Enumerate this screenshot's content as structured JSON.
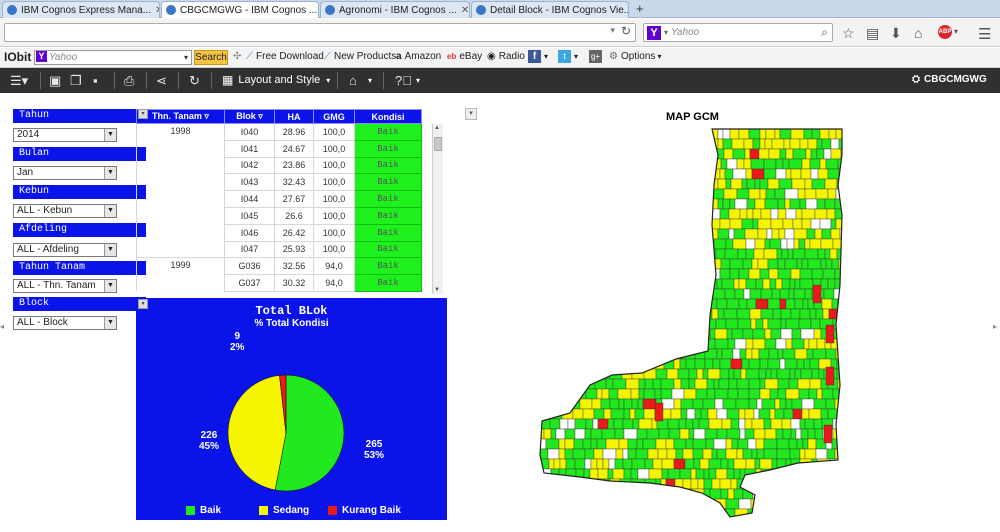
{
  "tabs": [
    {
      "title": "IBM Cognos Express Mana...",
      "active": false
    },
    {
      "title": "CBGCMGWG - IBM Cognos ...",
      "active": true
    },
    {
      "title": "Agronomi - IBM Cognos ...",
      "active": false
    },
    {
      "title": "Detail Block - IBM Cognos Vie...",
      "active": false
    }
  ],
  "search_engine": {
    "name": "Yahoo",
    "placeholder": "Yahoo"
  },
  "iobit_toolbar": {
    "brand": "IObit",
    "search_placeholder": "Yahoo",
    "search_button": "Search",
    "links": [
      "Free Download",
      "New Products",
      "Amazon",
      "eBay",
      "Radio",
      "Options"
    ]
  },
  "cognos_toolbar": {
    "layout_label": "Layout and Style",
    "report_name": "CBGCMGWG"
  },
  "prompts": [
    {
      "label": "Tahun",
      "value": "2014"
    },
    {
      "label": "Bulan",
      "value": "Jan"
    },
    {
      "label": "Kebun",
      "value": "ALL - Kebun"
    },
    {
      "label": "Afdeling",
      "value": "ALL - Afdeling"
    },
    {
      "label": "Tahun Tanam",
      "value": "ALL - Thn. Tanam"
    },
    {
      "label": "Block",
      "value": "ALL - Block"
    }
  ],
  "table": {
    "headers": [
      "Thn. Tanam",
      "Blok",
      "HA",
      "GMG",
      "Kondisi"
    ],
    "groups": [
      {
        "year": "1998",
        "rows": [
          [
            "I040",
            "28.96",
            "100,0",
            "Baik"
          ],
          [
            "I041",
            "24.67",
            "100,0",
            "Baik"
          ],
          [
            "I042",
            "23.86",
            "100,0",
            "Baik"
          ],
          [
            "I043",
            "32.43",
            "100,0",
            "Baik"
          ],
          [
            "I044",
            "27.67",
            "100,0",
            "Baik"
          ],
          [
            "I045",
            "26.6",
            "100,0",
            "Baik"
          ],
          [
            "I046",
            "26.42",
            "100,0",
            "Baik"
          ],
          [
            "I047",
            "25.93",
            "100,0",
            "Baik"
          ]
        ]
      },
      {
        "year": "1999",
        "rows": [
          [
            "G036",
            "32.56",
            "94,0",
            "Baik"
          ],
          [
            "G037",
            "30.32",
            "94,0",
            "Baik"
          ]
        ]
      }
    ]
  },
  "pie": {
    "title": "Total BLok",
    "subtitle": "% Total Kondisi",
    "colors": {
      "Baik": "#22e81e",
      "Sedang": "#f5f500",
      "Kurang Baik": "#e81a1a"
    },
    "legend": [
      "Baik",
      "Sedang",
      "Kurang Baik"
    ],
    "slices": [
      {
        "name": "Baik",
        "count": "265",
        "pct": "53%",
        "value": 265
      },
      {
        "name": "Sedang",
        "count": "226",
        "pct": "45%",
        "value": 226
      },
      {
        "name": "Kurang Baik",
        "count": "9",
        "pct": "2%",
        "value": 9
      }
    ]
  },
  "chart_data": {
    "type": "pie",
    "title": "Total BLok",
    "subtitle": "% Total Kondisi",
    "categories": [
      "Baik",
      "Sedang",
      "Kurang Baik"
    ],
    "values": [
      265,
      226,
      9
    ],
    "percent": [
      53,
      45,
      2
    ]
  },
  "map": {
    "title": "MAP GCM"
  }
}
